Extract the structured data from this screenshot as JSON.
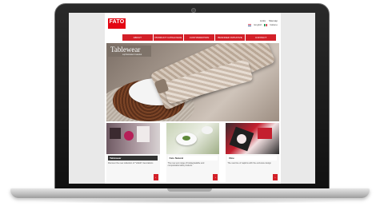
{
  "brand": {
    "logo": "FATO",
    "tagline": "the perfect table",
    "accent_color": "#d32028"
  },
  "header": {
    "top_links": [
      "Links",
      "Sitemap"
    ],
    "languages": [
      "English",
      "Italiano"
    ]
  },
  "nav": {
    "items": [
      "ABOUT",
      "PRODUCT CATALOGUE",
      "CUSTOMIZATION",
      "BRANDED INITIATIVE",
      "CONTACT"
    ]
  },
  "hero": {
    "title": "Tablewear",
    "subtitle": "sophisticated material"
  },
  "cards": [
    {
      "title": "Tablewear",
      "description": "Discover the new collection of \"Vollolit\" decorations",
      "more_label": "›"
    },
    {
      "title": "Fato Natural",
      "description": "The new eco range of biodegradable and compostable table products",
      "more_label": "›"
    },
    {
      "title": "Dine",
      "description": "The new line of napkins with the exclusive design",
      "more_label": "›"
    }
  ]
}
